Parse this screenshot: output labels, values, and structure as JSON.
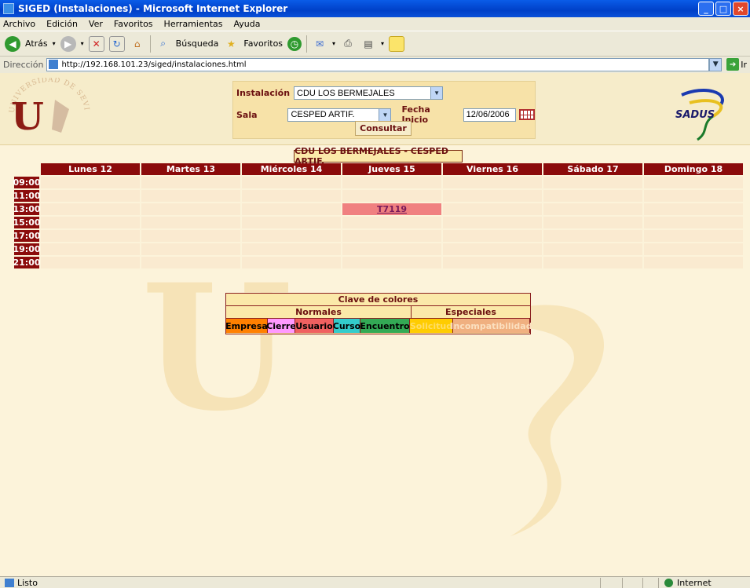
{
  "window": {
    "title": "SIGED (Instalaciones) - Microsoft Internet Explorer"
  },
  "menu": [
    "Archivo",
    "Edición",
    "Ver",
    "Favoritos",
    "Herramientas",
    "Ayuda"
  ],
  "toolbar": {
    "back_label": "Atrás",
    "search_label": "Búsqueda",
    "favorites_label": "Favoritos"
  },
  "address": {
    "label": "Dirección",
    "url": "http://192.168.101.23/siged/instalaciones.html",
    "go_label": "Ir"
  },
  "logos": {
    "left_text": "UNIVERSIDAD DE SEVILLA",
    "left_letter": "U",
    "right_text": "SADUS"
  },
  "form": {
    "instalacion_label": "Instalación",
    "instalacion_value": "CDU LOS BERMEJALES",
    "sala_label": "Sala",
    "sala_value": "CESPED ARTIF.",
    "fecha_label": "Fecha Inicio",
    "fecha_value": "12/06/2006",
    "consultar_label": "Consultar"
  },
  "schedule": {
    "title": "CDU LOS BERMEJALES - CESPED ARTIF.",
    "days": [
      "Lunes 12",
      "Martes 13",
      "Miércoles 14",
      "Jueves 15",
      "Viernes 16",
      "Sábado 17",
      "Domingo 18"
    ],
    "hours": [
      "09:00",
      "11:00",
      "13:00",
      "15:00",
      "17:00",
      "19:00",
      "21:00"
    ],
    "booking": {
      "hour": "13:00",
      "day": "Jueves 15",
      "code": "T7119"
    }
  },
  "legend": {
    "title": "Clave de colores",
    "normales": "Normales",
    "especiales": "Especiales",
    "keys": [
      {
        "label": "Empresa",
        "color": "#ff8000",
        "text": "#000000"
      },
      {
        "label": "Cierre",
        "color": "#ff99ff",
        "text": "#000000"
      },
      {
        "label": "Usuario",
        "color": "#f06060",
        "text": "#000000"
      },
      {
        "label": "Curso",
        "color": "#33cccc",
        "text": "#000000"
      },
      {
        "label": "Encuentro",
        "color": "#33aa55",
        "text": "#000000"
      },
      {
        "label": "Solicitud",
        "color": "#ffcc00",
        "text": "#ffdd66"
      },
      {
        "label": "Incompatibilidad",
        "color": "#f0b080",
        "text": "#fbe0c0"
      }
    ]
  },
  "status": {
    "text": "Listo",
    "zone": "Internet"
  },
  "colors": {
    "header_red": "#8b0b0b",
    "booking": "#f08080",
    "cell": "#faead0"
  }
}
